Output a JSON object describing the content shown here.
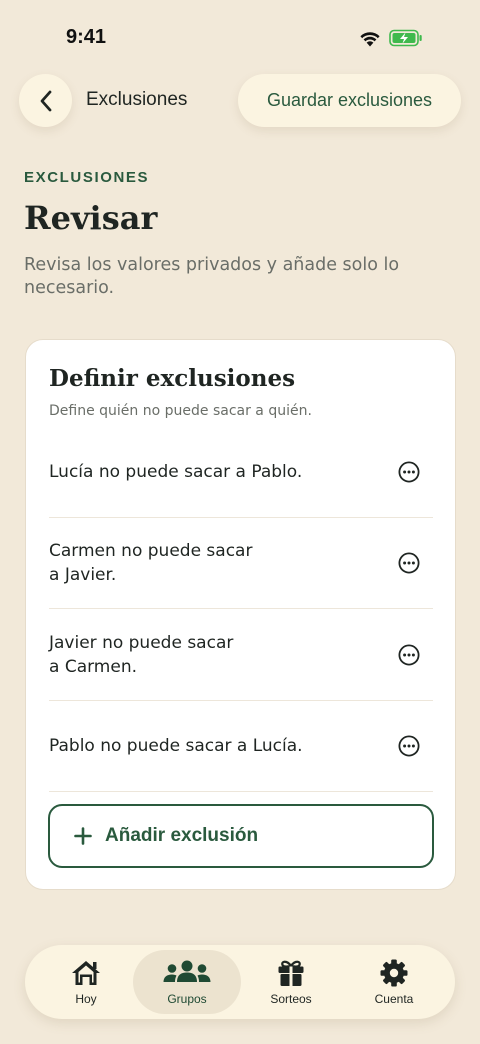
{
  "status_bar": {
    "time": "9:41"
  },
  "header": {
    "title": "Exclusiones",
    "save_label": "Guardar exclusiones"
  },
  "intro": {
    "eyebrow": "EXCLUSIONES",
    "title": "Revisar",
    "subtitle": "Revisa los valores privados y añade solo lo necesario."
  },
  "card": {
    "title": "Definir exclusiones",
    "subtitle": "Define quién no puede sacar a quién.",
    "rules": [
      {
        "line1": "Lucía no puede sacar a Pablo.",
        "line2": ""
      },
      {
        "line1": "Carmen no puede sacar",
        "line2": "a Javier."
      },
      {
        "line1": "Javier no puede sacar",
        "line2": "a Carmen."
      },
      {
        "line1": "Pablo no puede sacar a Lucía.",
        "line2": ""
      }
    ],
    "add_label": "Añadir exclusión"
  },
  "tabs": [
    {
      "label": "Hoy",
      "icon": "home-icon",
      "active": false
    },
    {
      "label": "Grupos",
      "icon": "users-icon",
      "active": true
    },
    {
      "label": "Sorteos",
      "icon": "gift-icon",
      "active": false
    },
    {
      "label": "Cuenta",
      "icon": "gear-icon",
      "active": false
    }
  ],
  "colors": {
    "background": "#f2e9d9",
    "accent": "#2a5a3e",
    "surface": "#fbf4e1",
    "battery": "#3fb94d"
  }
}
